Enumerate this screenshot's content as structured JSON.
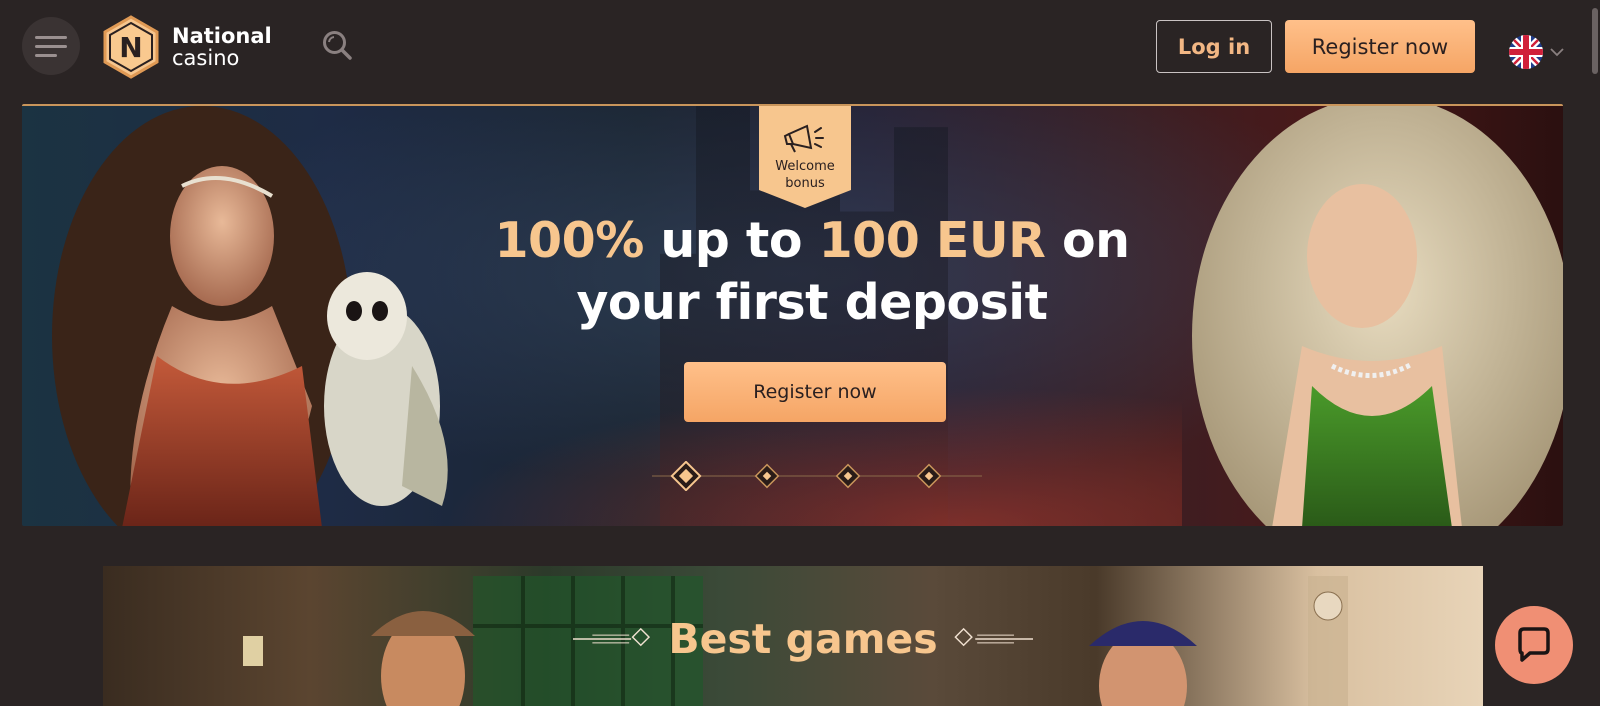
{
  "header": {
    "logo": {
      "line1": "National",
      "line2": "casino",
      "badge_letter": "N"
    },
    "login_label": "Log in",
    "register_label": "Register now",
    "language_icon": "uk-flag-icon"
  },
  "hero": {
    "badge": {
      "line1": "Welcome",
      "line2": "bonus",
      "icon": "megaphone-icon"
    },
    "title": {
      "part1": "100%",
      "part2": " up to ",
      "part3": "100 EUR",
      "part4": " on",
      "line2": "your first deposit"
    },
    "cta_label": "Register now",
    "slides": {
      "count": 4,
      "active": 1
    }
  },
  "games_section": {
    "title": "Best games"
  },
  "colors": {
    "background": "#2a2424",
    "accent": "#f7c68e",
    "button": "#f5a565",
    "chat": "#f08f74"
  },
  "chat": {
    "icon": "chat-bubble-icon"
  }
}
